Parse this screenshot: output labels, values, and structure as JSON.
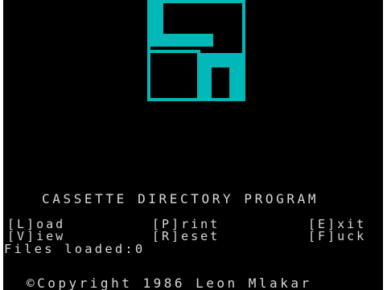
{
  "title": "CASSETTE DIRECTORY PROGRAM",
  "menu": {
    "load": "[L]oad",
    "print": "[P]rint",
    "exit": "[E]xit",
    "view": "[V]iew",
    "reset": "[R]eset",
    "fuck": "[F]uck"
  },
  "files_loaded": "Files loaded:0",
  "copyright": "©Copyright 1986 Leon Mlakar",
  "colors": {
    "background": "#000000",
    "logo": "#00b8b8",
    "text": "#d8d8d8"
  },
  "logo_icon": "lm-logo-icon"
}
